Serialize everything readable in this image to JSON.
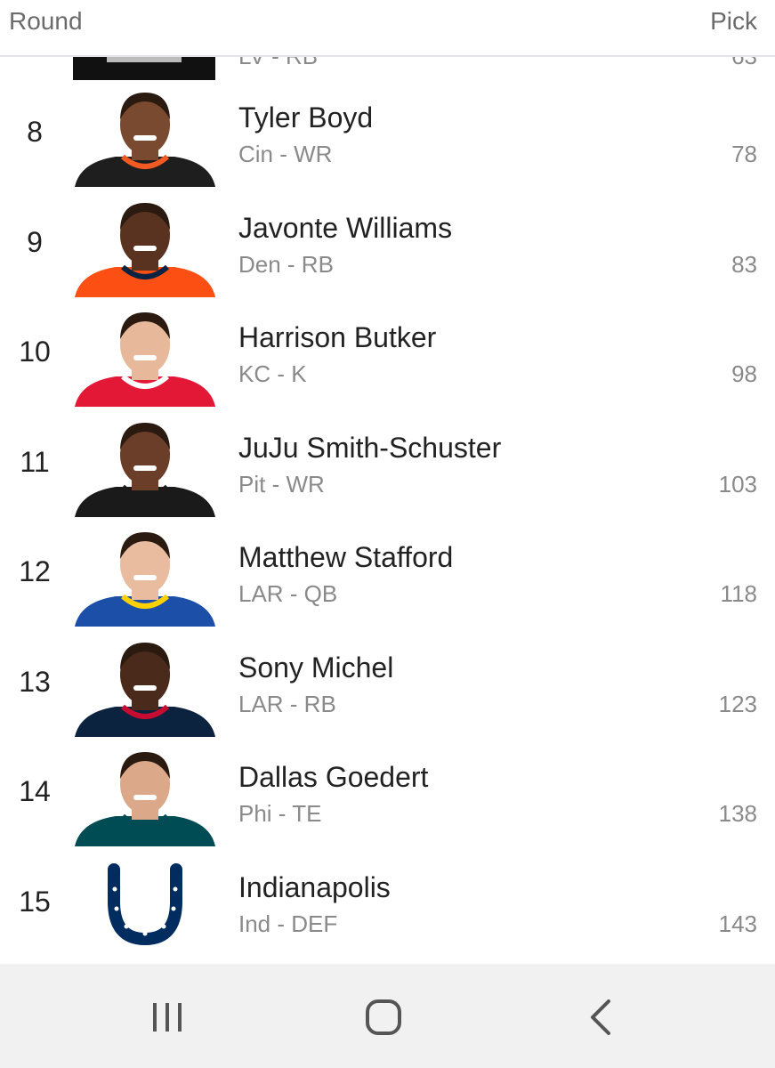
{
  "header": {
    "round_label": "Round",
    "pick_label": "Pick"
  },
  "partial_row": {
    "team": "LV - RB",
    "pick": "63"
  },
  "players": [
    {
      "round": "8",
      "name": "Tyler Boyd",
      "team": "Cin - WR",
      "pick": "78",
      "jersey_color": "#1e1e1e",
      "trim_color": "#f15a22",
      "skin_color": "#7a4a30"
    },
    {
      "round": "9",
      "name": "Javonte Williams",
      "team": "Den - RB",
      "pick": "83",
      "jersey_color": "#fb4f14",
      "trim_color": "#0a2343",
      "skin_color": "#5a3220"
    },
    {
      "round": "10",
      "name": "Harrison Butker",
      "team": "KC - K",
      "pick": "98",
      "jersey_color": "#e31837",
      "trim_color": "#ffffff",
      "skin_color": "#e8b89a"
    },
    {
      "round": "11",
      "name": "JuJu Smith-Schuster",
      "team": "Pit - WR",
      "pick": "103",
      "jersey_color": "#1a1a1a",
      "trim_color": "#1a1a1a",
      "skin_color": "#6a3e28"
    },
    {
      "round": "12",
      "name": "Matthew Stafford",
      "team": "LAR - QB",
      "pick": "118",
      "jersey_color": "#1c4fa8",
      "trim_color": "#ffd100",
      "skin_color": "#e9bca0"
    },
    {
      "round": "13",
      "name": "Sony Michel",
      "team": "LAR - RB",
      "pick": "123",
      "jersey_color": "#0c2340",
      "trim_color": "#c60c30",
      "skin_color": "#4a2a1a"
    },
    {
      "round": "14",
      "name": "Dallas Goedert",
      "team": "Phi - TE",
      "pick": "138",
      "jersey_color": "#004c54",
      "trim_color": "#004c54",
      "skin_color": "#dca88a"
    },
    {
      "round": "15",
      "name": "Indianapolis",
      "team": "Ind - DEF",
      "pick": "143",
      "logo": "horseshoe-logo",
      "logo_color": "#002c5f"
    }
  ],
  "navbar": {
    "recents": "recents-icon",
    "home": "home-icon",
    "back": "back-icon"
  }
}
